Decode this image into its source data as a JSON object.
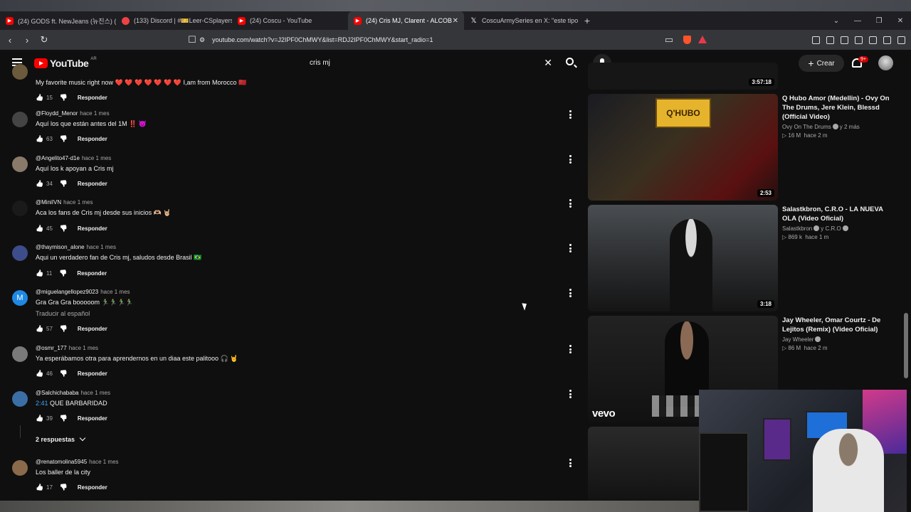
{
  "browser": {
    "tabs": [
      {
        "label": "(24) GODS ft. NewJeans (뉴진스) (Vi",
        "icon": "youtube-icon",
        "active": false
      },
      {
        "label": "(133) Discord | #🎫Leer-CSplayers",
        "icon": "discord-icon",
        "active": false
      },
      {
        "label": "(24) Coscu - YouTube",
        "icon": "youtube-icon",
        "active": false
      },
      {
        "label": "(24) Cris MJ, Clarent - ALCOB",
        "icon": "youtube-icon",
        "active": true
      },
      {
        "label": "CoscuArmySeries en X: \"este tipo me",
        "icon": "x-icon",
        "active": false
      }
    ],
    "url": "youtube.com/watch?v=J2IPF0ChMWY&list=RDJ2IPF0ChMWY&start_radio=1"
  },
  "header": {
    "logo": "YouTube",
    "region": "AR",
    "search_value": "cris mj",
    "create_label": "Crear",
    "notif_count": "9+"
  },
  "comments": [
    {
      "author": "",
      "time": "",
      "text": "My favorite music right now ❤️ ❤️ ❤️ ❤️ ❤️ ❤️ ❤️ I,am from Morocco 🇲🇦",
      "likes": "15",
      "reply": "Responder",
      "translate": ""
    },
    {
      "author": "@Floydd_Menor",
      "time": "hace 1 mes",
      "text": "Aquí los que están antes del 1M ‼️ 😈",
      "likes": "63",
      "reply": "Responder",
      "translate": ""
    },
    {
      "author": "@Angelito47-d1e",
      "time": "hace 1 mes",
      "text": "Aquí los k apoyan a Cris mj",
      "likes": "34",
      "reply": "Responder",
      "translate": ""
    },
    {
      "author": "@MiniIVN",
      "time": "hace 1 mes",
      "text": "Aca los fans de Cris mj desde sus inicios 🫶🏼 🤘🏼",
      "likes": "45",
      "reply": "Responder",
      "translate": ""
    },
    {
      "author": "@thaymison_alone",
      "time": "hace 1 mes",
      "text": "Aqui un verdadero fan de Cris mj, saludos desde Brasil 🇧🇷",
      "likes": "11",
      "reply": "Responder",
      "translate": ""
    },
    {
      "author": "@miguelangellopez9023",
      "time": "hace 1 mes",
      "text": "Gra Gra Gra booooom 🏃‍♂️🏃‍♂️🏃‍♂️🏃‍♂️",
      "likes": "57",
      "reply": "Responder",
      "translate": "Traducir al español"
    },
    {
      "author": "@osmr_177",
      "time": "hace 1 mes",
      "text": "Ya esperábamos otra para aprendernos en un diaa este palitooo 🎧 🤘",
      "likes": "46",
      "reply": "Responder",
      "translate": ""
    },
    {
      "author": "@Salchichababa",
      "time": "hace 1 mes",
      "timestamp": "2:41",
      "text": "QUE BARBARIDAD",
      "likes": "39",
      "reply": "Responder",
      "translate": ""
    },
    {
      "author": "@renatomolina5945",
      "time": "hace 1 mes",
      "text": "Los baller de la city",
      "likes": "17",
      "reply": "Responder",
      "translate": ""
    }
  ],
  "replies_toggle": "2 respuestas",
  "sidebar": {
    "top_duration": "3:57:18",
    "videos": [
      {
        "title": "Q Hubo Amor (Medellin) - Ovy On The Drums, Jere Klein, Blessd (Official Video)",
        "channel": "Ovy On The Drums",
        "channel_extra": "y 2 más",
        "views": "16 M",
        "age": "hace 2 m",
        "duration": "2:53",
        "thumb_text": "Q'HUBO AMOR"
      },
      {
        "title": "Salastkbron, C.R.O - LA NUEVA OLA (Video Oficial)",
        "channel": "Salastkbron",
        "channel_extra": "y C.R.O",
        "views": "869 k",
        "age": "hace 1 m",
        "duration": "3:18",
        "thumb_text": ""
      },
      {
        "title": "Jay Wheeler, Omar Courtz - De Lejitos (Remix) (Video Oficial)",
        "channel": "Jay Wheeler",
        "channel_extra": "",
        "views": "86 M",
        "age": "hace 2 m",
        "duration": "",
        "thumb_text": "vevo"
      }
    ]
  }
}
